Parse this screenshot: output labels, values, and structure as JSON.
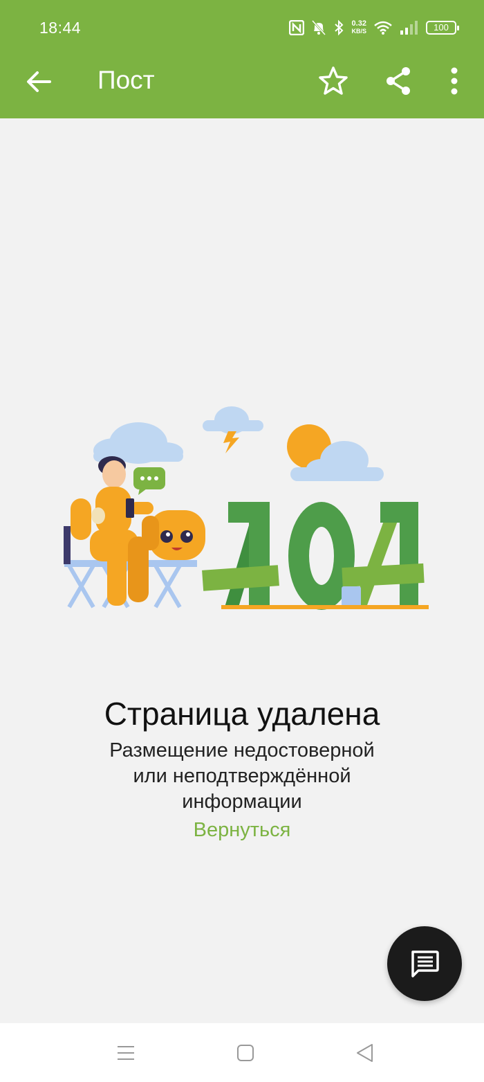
{
  "status_bar": {
    "time": "18:44",
    "speed_value": "0.32",
    "speed_unit": "KB/S",
    "battery": "100"
  },
  "app_bar": {
    "title": "Пост",
    "icons": [
      "back-arrow-icon",
      "star-outline-icon",
      "share-icon",
      "more-vert-icon"
    ]
  },
  "error": {
    "title": "Страница удалена",
    "subtitle": "Размещение недостоверной или неподтверждённой информации",
    "link": "Вернуться",
    "illustration_text": "404"
  },
  "fab": {
    "icon": "comment-icon"
  },
  "nav_bar": {
    "icons": [
      "menu-icon",
      "home-square-icon",
      "back-triangle-icon"
    ]
  },
  "colors": {
    "primary": "#7cb342",
    "background": "#f2f2f2",
    "fab": "#1b1b1b",
    "text": "#111111"
  }
}
